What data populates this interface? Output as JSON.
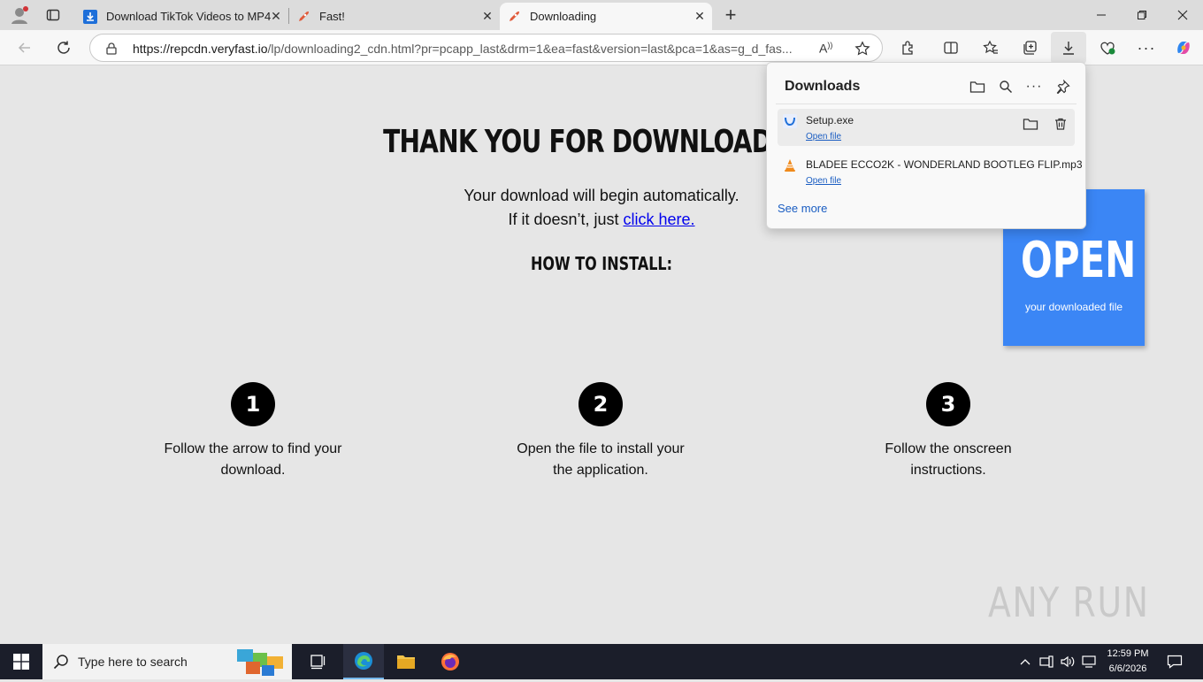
{
  "browser": {
    "tabs": [
      {
        "title": "Download TikTok Videos to MP4",
        "icon": "download-arrow-favicon",
        "active": false
      },
      {
        "title": "Fast!",
        "icon": "rocket-favicon",
        "active": false
      },
      {
        "title": "Downloading",
        "icon": "rocket-favicon",
        "active": true
      }
    ],
    "new_tab_label": "+",
    "url_domain": "https://repcdn.veryfast.io",
    "url_path": "/lp/downloading2_cdn.html?pr=pcapp_last&drm=1&ea=fast&version=last&pca=1&as=g_d_fas...",
    "accent_color": "#3b86f5"
  },
  "page": {
    "headline": "THANK YOU FOR DOWNLOADING",
    "line1": "Your download will begin automatically.",
    "line2_prefix": "If it doesn’t, just ",
    "line2_link": "click here.",
    "howto": "HOW TO INSTALL:",
    "steps": [
      {
        "num": "1",
        "text_a": "Follow the arrow to find your",
        "text_b": "download."
      },
      {
        "num": "2",
        "text_a": "Open the file to install your",
        "text_b": "the application."
      },
      {
        "num": "3",
        "text_a": "Follow the onscreen",
        "text_b": "instructions."
      }
    ],
    "open_box": {
      "big": "OPEN",
      "small": "your downloaded file"
    },
    "watermark": "ANY RUN"
  },
  "downloads": {
    "title": "Downloads",
    "items": [
      {
        "name": "Setup.exe",
        "action": "Open file",
        "icon": "installer-icon"
      },
      {
        "name": "BLADEE ECCO2K - WONDERLAND BOOTLEG FLIP.mp3",
        "action": "Open file",
        "icon": "vlc-cone-icon"
      }
    ],
    "see_more": "See more"
  },
  "taskbar": {
    "search_placeholder": "Type here to search",
    "time": "12:59 PM",
    "date": "6/6/2026"
  }
}
